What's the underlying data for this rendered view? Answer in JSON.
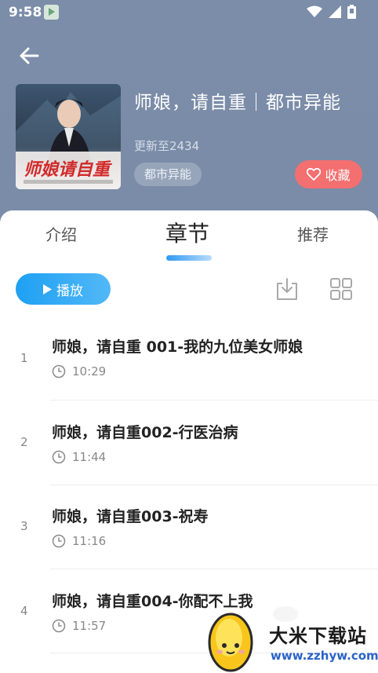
{
  "status_bar": {
    "time": "9:58"
  },
  "book": {
    "title": "师娘，请自重｜都市异能",
    "update": "更新至2434",
    "genre": "都市异能",
    "favorite_label": "收藏",
    "cover_text": "师娘请自重"
  },
  "tabs": [
    {
      "label": "介绍"
    },
    {
      "label": "章节"
    },
    {
      "label": "推荐"
    }
  ],
  "toolbar": {
    "play_label": "播放"
  },
  "chapters": [
    {
      "index": "1",
      "title": "师娘，请自重 001-我的九位美女师娘",
      "duration": "10:29"
    },
    {
      "index": "2",
      "title": "师娘，请自重002-行医治病",
      "duration": "11:44"
    },
    {
      "index": "3",
      "title": "师娘，请自重003-祝寿",
      "duration": "11:16"
    },
    {
      "index": "4",
      "title": "师娘，请自重004-你配不上我",
      "duration": "11:57"
    }
  ],
  "watermark": {
    "title": "大米下载站",
    "url": "www.zzhyw.com"
  },
  "colors": {
    "header": "#7b8da8",
    "accent": "#1ea0f3",
    "favorite": "#f46f70"
  }
}
